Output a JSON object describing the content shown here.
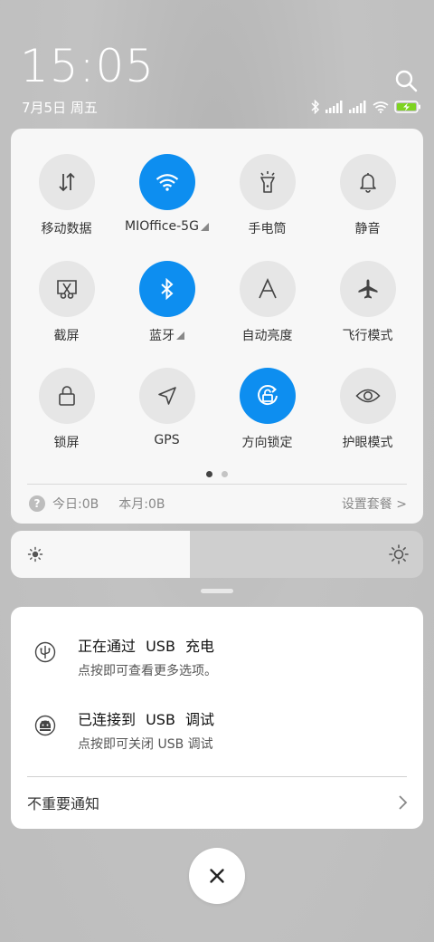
{
  "status": {
    "time": "15:05",
    "date": "7月5日 周五"
  },
  "quick_settings": {
    "tiles": [
      {
        "label": "移动数据",
        "icon": "mobile-data-icon",
        "active": false
      },
      {
        "label": "MIOffice-5G",
        "icon": "wifi-icon",
        "active": true,
        "expandable": true
      },
      {
        "label": "手电筒",
        "icon": "flashlight-icon",
        "active": false
      },
      {
        "label": "静音",
        "icon": "bell-icon",
        "active": false
      },
      {
        "label": "截屏",
        "icon": "screenshot-icon",
        "active": false
      },
      {
        "label": "蓝牙",
        "icon": "bluetooth-icon",
        "active": true,
        "expandable": true
      },
      {
        "label": "自动亮度",
        "icon": "auto-brightness-icon",
        "active": false
      },
      {
        "label": "飞行模式",
        "icon": "airplane-icon",
        "active": false
      },
      {
        "label": "锁屏",
        "icon": "lock-icon",
        "active": false
      },
      {
        "label": "GPS",
        "icon": "location-arrow-icon",
        "active": false
      },
      {
        "label": "方向锁定",
        "icon": "rotation-lock-icon",
        "active": true
      },
      {
        "label": "护眼模式",
        "icon": "eye-icon",
        "active": false
      }
    ],
    "page_count": 2,
    "current_page": 1
  },
  "data_usage": {
    "help_glyph": "?",
    "today": "今日:0B",
    "month": "本月:0B",
    "settings_link": "设置套餐 >"
  },
  "brightness": {
    "level": 0.435
  },
  "notifications": [
    {
      "title": "正在通过 USB 充电",
      "subtitle": "点按即可查看更多选项。",
      "icon": "usb-icon"
    },
    {
      "title": "已连接到 USB 调试",
      "subtitle": "点按即可关闭 USB 调试",
      "icon": "android-debug-icon"
    }
  ],
  "unimportant": {
    "label": "不重要通知"
  },
  "colors": {
    "accent": "#0d8ef0",
    "tile_inactive": "#e6e6e6",
    "battery_green": "#7ed321"
  }
}
